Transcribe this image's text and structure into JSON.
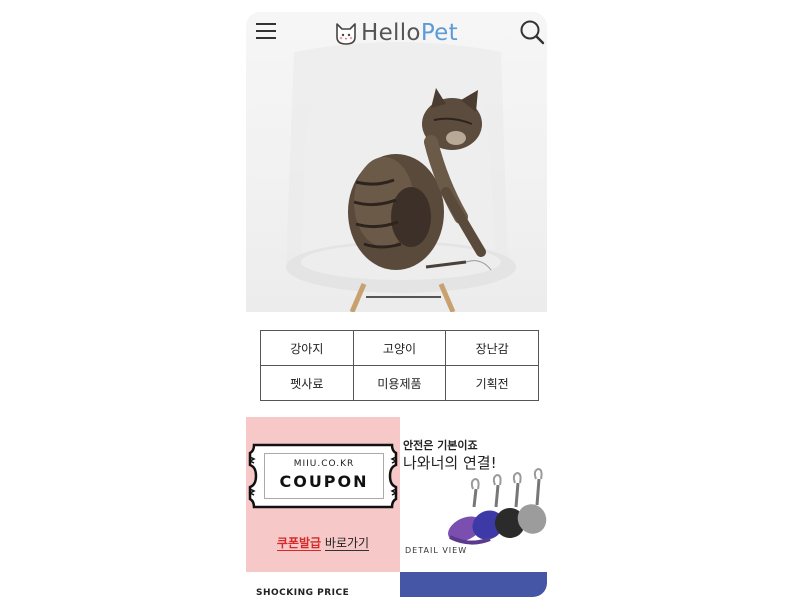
{
  "header": {
    "logo_hello": "Hello",
    "logo_pet": "Pet"
  },
  "colors": {
    "brand_blue": "#5c9bd6",
    "coupon_bg": "#f7c8c8",
    "accent_red": "#d42a2a",
    "bottom_blue": "#4656a6"
  },
  "categories": {
    "row1": [
      "강아지",
      "고양이",
      "장난감"
    ],
    "row2": [
      "펫사료",
      "미용제품",
      "기획전"
    ]
  },
  "banners": {
    "coupon": {
      "site": "MIIU.CO.KR",
      "word": "COUPON",
      "link_highlight": "쿠폰발급",
      "link_rest": "바로가기"
    },
    "leash": {
      "line1": "안전은 기본이죠",
      "line2": "나와너의 연결!",
      "detail": "DETAIL VIEW"
    },
    "bottom_left_text": "SHOCKING PRICE"
  }
}
